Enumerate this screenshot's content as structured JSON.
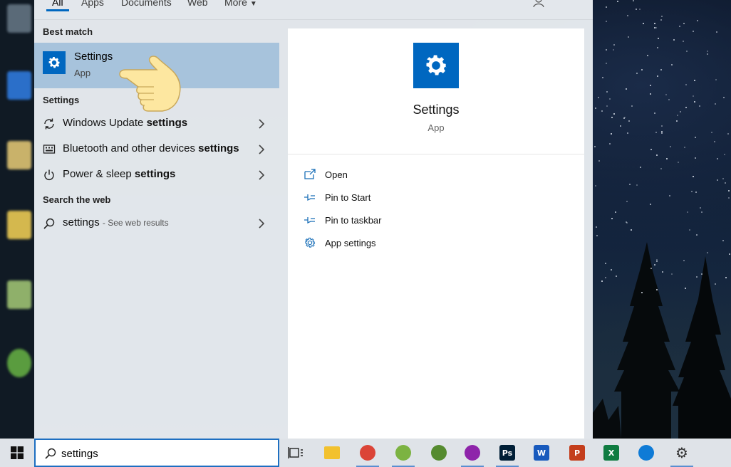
{
  "tabs": [
    {
      "label": "All",
      "active": true
    },
    {
      "label": "Apps",
      "active": false
    },
    {
      "label": "Documents",
      "active": false
    },
    {
      "label": "Web",
      "active": false
    },
    {
      "label": "More",
      "active": false
    }
  ],
  "results": {
    "best_match_heading": "Best match",
    "best_match": {
      "title": "Settings",
      "subtitle": "App",
      "icon": "gear-icon"
    },
    "settings_heading": "Settings",
    "settings_items": [
      {
        "label": "Windows Update",
        "bold": "settings",
        "icon": "refresh-icon"
      },
      {
        "label": "Bluetooth and other devices",
        "bold": "settings",
        "icon": "keyboard-icon"
      },
      {
        "label": "Power & sleep",
        "bold": "settings",
        "icon": "power-icon"
      }
    ],
    "web_heading": "Search the web",
    "web_item": {
      "label": "settings",
      "hint": "- See web results",
      "icon": "search-icon"
    }
  },
  "detail": {
    "title": "Settings",
    "subtitle": "App",
    "actions": [
      {
        "label": "Open",
        "icon": "open-icon"
      },
      {
        "label": "Pin to Start",
        "icon": "pin-icon"
      },
      {
        "label": "Pin to taskbar",
        "icon": "pin-icon"
      },
      {
        "label": "App settings",
        "icon": "gear-icon"
      }
    ]
  },
  "search": {
    "value": "settings"
  },
  "taskbar": {
    "apps": [
      {
        "name": "file-explorer-icon",
        "glyph": "",
        "color": "#f2c12e"
      },
      {
        "name": "chrome-icon",
        "glyph": "",
        "color": "#db4437"
      },
      {
        "name": "chrome-profile-icon",
        "glyph": "",
        "color": "#7cb342"
      },
      {
        "name": "chrome-profile-icon",
        "glyph": "",
        "color": "#558b2f"
      },
      {
        "name": "chrome-profile-icon",
        "glyph": "",
        "color": "#8e24aa"
      },
      {
        "name": "photoshop-icon",
        "glyph": "Ps",
        "color": "#001e36"
      },
      {
        "name": "word-icon",
        "glyph": "W",
        "color": "#185abd"
      },
      {
        "name": "powerpoint-icon",
        "glyph": "P",
        "color": "#c43e1c"
      },
      {
        "name": "excel-icon",
        "glyph": "X",
        "color": "#107c41"
      },
      {
        "name": "edge-icon",
        "glyph": "",
        "color": "#0f7bd6"
      },
      {
        "name": "settings-app-icon",
        "glyph": "",
        "color": "#333333"
      }
    ]
  },
  "colors": {
    "accent": "#0067c0",
    "highlight": "#a7c3dc"
  }
}
